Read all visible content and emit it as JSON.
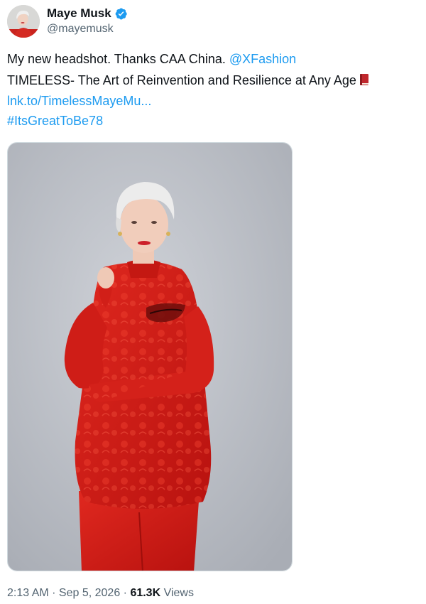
{
  "author": {
    "display_name": "Maye Musk",
    "handle": "@mayemusk",
    "avatar_icon": "profile-photo",
    "verified": true,
    "verified_color": "#1d9bf0"
  },
  "post": {
    "line1_text": "My new headshot. Thanks CAA China. ",
    "line1_mention": "@XFashion",
    "line2_text": "TIMELESS- The Art of Reinvention and Resilience at Any Age",
    "line2_emoji": "closed-book-icon",
    "link_text": "lnk.to/TimelessMayeMu...",
    "hashtag": "#ItsGreatToBe78"
  },
  "media": {
    "alt": "Portrait of a woman with short white hair wearing a red embroidered outfit"
  },
  "meta": {
    "time": "2:13 AM",
    "separator1": " · ",
    "date": "Sep 5, 2026",
    "separator2": " · ",
    "views_count": "61.3K",
    "views_label": " Views"
  },
  "colors": {
    "link": "#1d9bf0",
    "text": "#0f1419",
    "secondary": "#536471"
  }
}
